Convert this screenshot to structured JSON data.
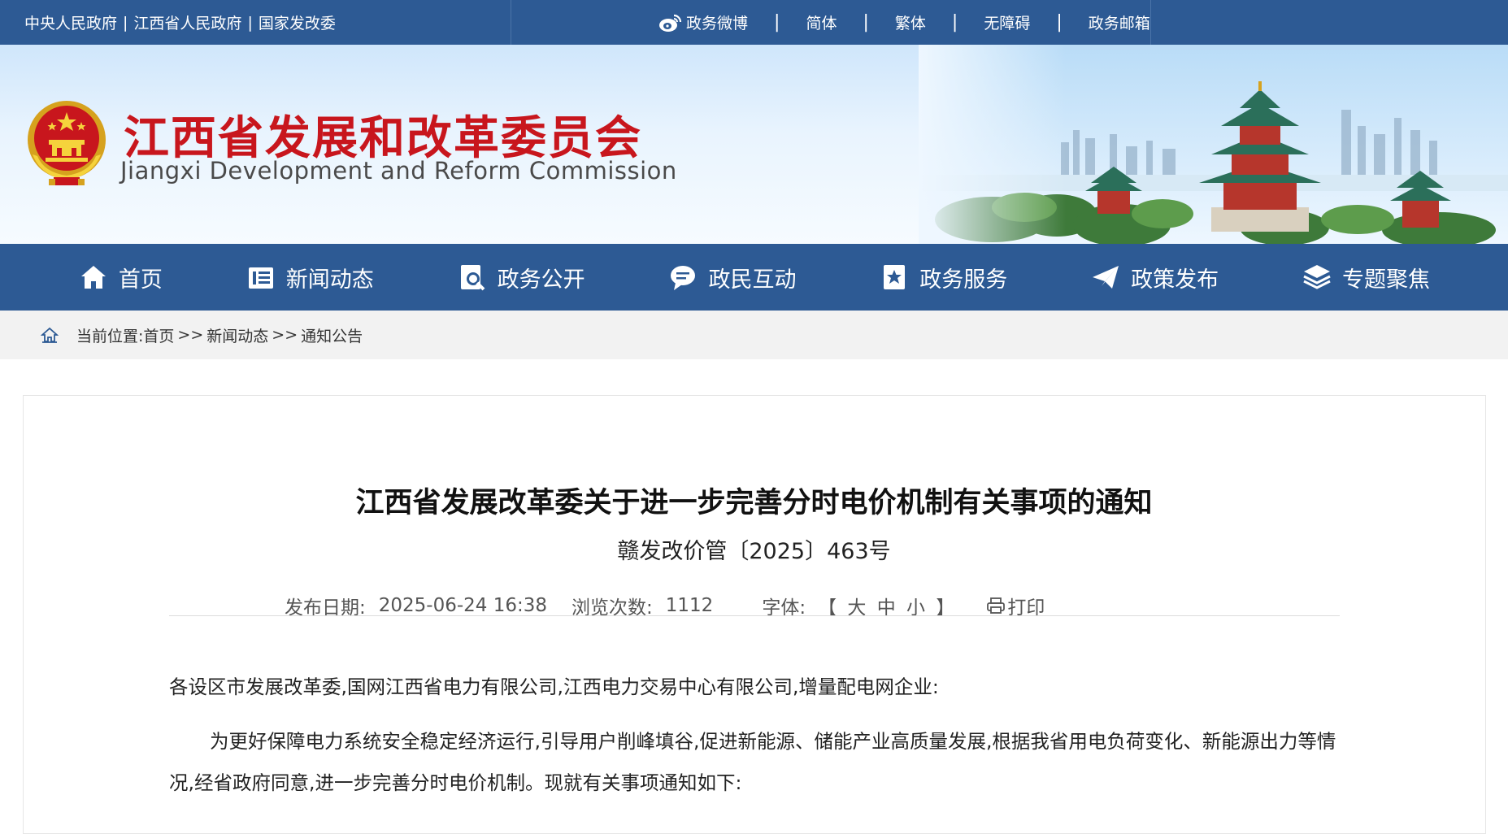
{
  "top_links": [
    "中央人民政府",
    "江西省人民政府",
    "国家发改委"
  ],
  "top_separator": "|",
  "top_right": {
    "weibo": "政务微博",
    "simplified": "简体",
    "traditional": "繁体",
    "accessibility": "无障碍",
    "mailbox": "政务邮箱"
  },
  "header": {
    "org_cn": "江西省发展和改革委员会",
    "org_en": "Jiangxi Development and Reform Commission"
  },
  "nav": [
    {
      "label": "首页",
      "icon": "home-icon"
    },
    {
      "label": "新闻动态",
      "icon": "news-icon"
    },
    {
      "label": "政务公开",
      "icon": "search-doc-icon"
    },
    {
      "label": "政民互动",
      "icon": "chat-icon"
    },
    {
      "label": "政务服务",
      "icon": "star-doc-icon"
    },
    {
      "label": "政策发布",
      "icon": "paper-plane-icon"
    },
    {
      "label": "专题聚焦",
      "icon": "layers-icon"
    }
  ],
  "breadcrumb": {
    "prefix": "当前位置:",
    "items": [
      "首页",
      "新闻动态",
      "通知公告"
    ],
    "separator": ">>"
  },
  "article": {
    "title": "江西省发展改革委关于进一步完善分时电价机制有关事项的通知",
    "doc_number": "赣发改价管〔2025〕463号",
    "date_label": "发布日期:",
    "date": "2025-06-24 16:38",
    "views_label": "浏览次数:",
    "views": "1112",
    "font_label": "字体:",
    "font_open": "【",
    "font_large": "大",
    "font_medium": "中",
    "font_small": "小",
    "font_close": "】",
    "print": "打印",
    "greeting": "各设区市发展改革委,国网江西省电力有限公司,江西电力交易中心有限公司,增量配电网企业:",
    "paragraph1": "为更好保障电力系统安全稳定经济运行,引导用户削峰填谷,促进新能源、储能产业高质量发展,根据我省用电负荷变化、新能源出力等情况,经省政府同意,进一步完善分时电价机制。现就有关事项通知如下:"
  },
  "colors": {
    "primary_blue": "#2d5a94",
    "title_red": "#c8161d",
    "breadcrumb_bg": "#f2f2f2"
  }
}
